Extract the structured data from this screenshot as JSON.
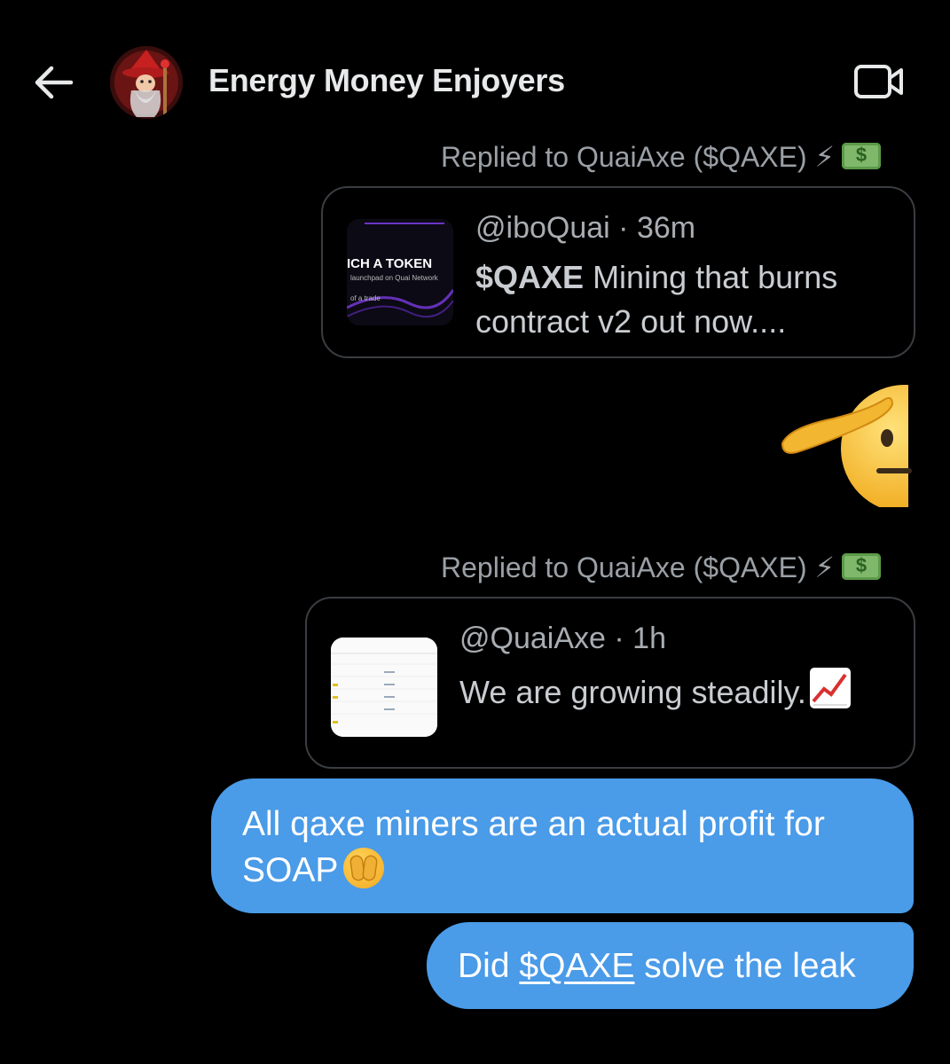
{
  "header": {
    "title": "Energy Money Enjoyers"
  },
  "messages": {
    "reply1": {
      "label": "Replied to QuaiAxe ($QAXE) ⚡",
      "author": "@iboQuai",
      "time": "36m",
      "sep": "·",
      "text_bold": "$QAXE",
      "text_rest": "Mining that burns contract v2 out now....",
      "thumb": {
        "line1": "ICH A TOKEN",
        "line2": "launchpad on Quai Network",
        "line3": "of a trade"
      }
    },
    "reply2": {
      "label": "Replied to QuaiAxe ($QAXE) ⚡",
      "author": "@QuaiAxe",
      "time": "1h",
      "sep": "·",
      "text": "We are growing steadily."
    },
    "bubble1": {
      "text": "All qaxe miners are an actual profit for SOAP"
    },
    "bubble2": {
      "pre": "Did",
      "link": "$QAXE",
      "post": "solve the leak"
    }
  },
  "colors": {
    "background": "#000000",
    "bubble": "#4a9be8",
    "border": "#3a3d41"
  },
  "icons": [
    "back-arrow-icon",
    "video-call-icon",
    "lightning-emoji",
    "money-emoji",
    "saluting-face-emoji",
    "face-with-peeking-eye-emoji",
    "chart-increasing-emoji"
  ]
}
